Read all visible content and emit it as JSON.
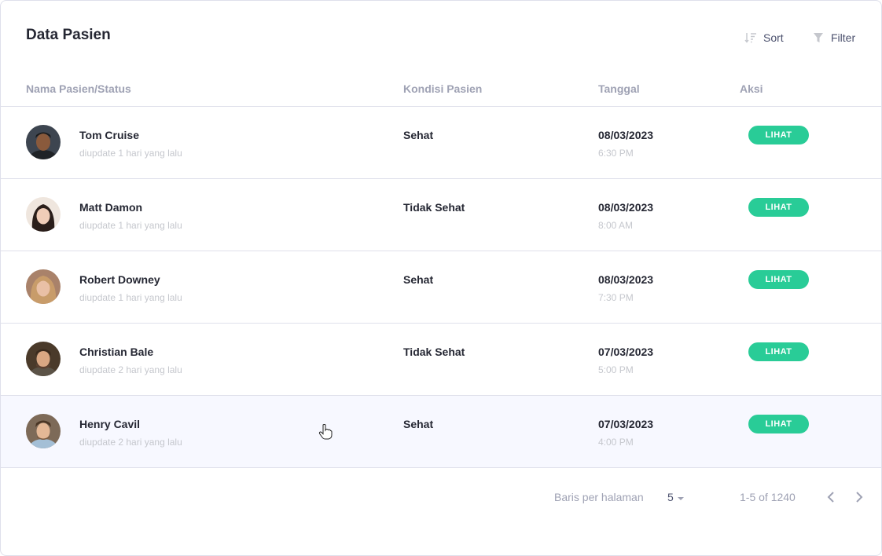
{
  "page": {
    "title": "Data Pasien"
  },
  "toolbar": {
    "sort_label": "Sort",
    "filter_label": "Filter",
    "sort_icon": "sort-icon",
    "filter_icon": "filter-icon"
  },
  "table": {
    "columns": [
      "Nama Pasien/Status",
      "Kondisi Pasien",
      "Tanggal",
      "Aksi"
    ],
    "rows": [
      {
        "name": "Tom Cruise",
        "updated": "diupdate 1 hari yang lalu",
        "condition": "Sehat",
        "date": "08/03/2023",
        "time": "6:30 PM",
        "action": "LIHAT"
      },
      {
        "name": "Matt Damon",
        "updated": "diupdate 1 hari yang lalu",
        "condition": "Tidak Sehat",
        "date": "08/03/2023",
        "time": "8:00 AM",
        "action": "LIHAT"
      },
      {
        "name": "Robert Downey",
        "updated": "diupdate 1 hari yang lalu",
        "condition": "Sehat",
        "date": "08/03/2023",
        "time": "7:30 PM",
        "action": "LIHAT"
      },
      {
        "name": "Christian Bale",
        "updated": "diupdate 2 hari yang lalu",
        "condition": "Tidak Sehat",
        "date": "07/03/2023",
        "time": "5:00 PM",
        "action": "LIHAT"
      },
      {
        "name": "Henry Cavil",
        "updated": "diupdate 2 hari yang lalu",
        "condition": "Sehat",
        "date": "07/03/2023",
        "time": "4:00 PM",
        "action": "LIHAT"
      }
    ]
  },
  "footer": {
    "rows_label": "Baris per halaman",
    "rows_value": "5",
    "range": "1-5 of 1240"
  },
  "colors": {
    "accent": "#29cc97",
    "hover_row": "#f7f8ff",
    "border": "#dfe0eb",
    "muted": "#9fa2b4"
  }
}
